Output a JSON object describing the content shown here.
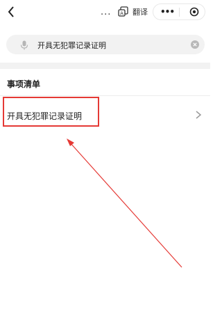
{
  "header": {
    "ellipsis": "...",
    "translate_label": "翻译",
    "capsule_more": "•••"
  },
  "search": {
    "query": "开具无犯罪记录证明"
  },
  "section": {
    "title": "事项清单"
  },
  "items": [
    {
      "label": "开具无犯罪记录证明"
    }
  ],
  "colors": {
    "highlight": "#e53935",
    "search_background": "#f2f2f2"
  },
  "icons": [
    "back-icon",
    "translate-icon",
    "more-icon",
    "close-icon",
    "microphone-icon",
    "clear-icon",
    "chevron-right-icon"
  ]
}
